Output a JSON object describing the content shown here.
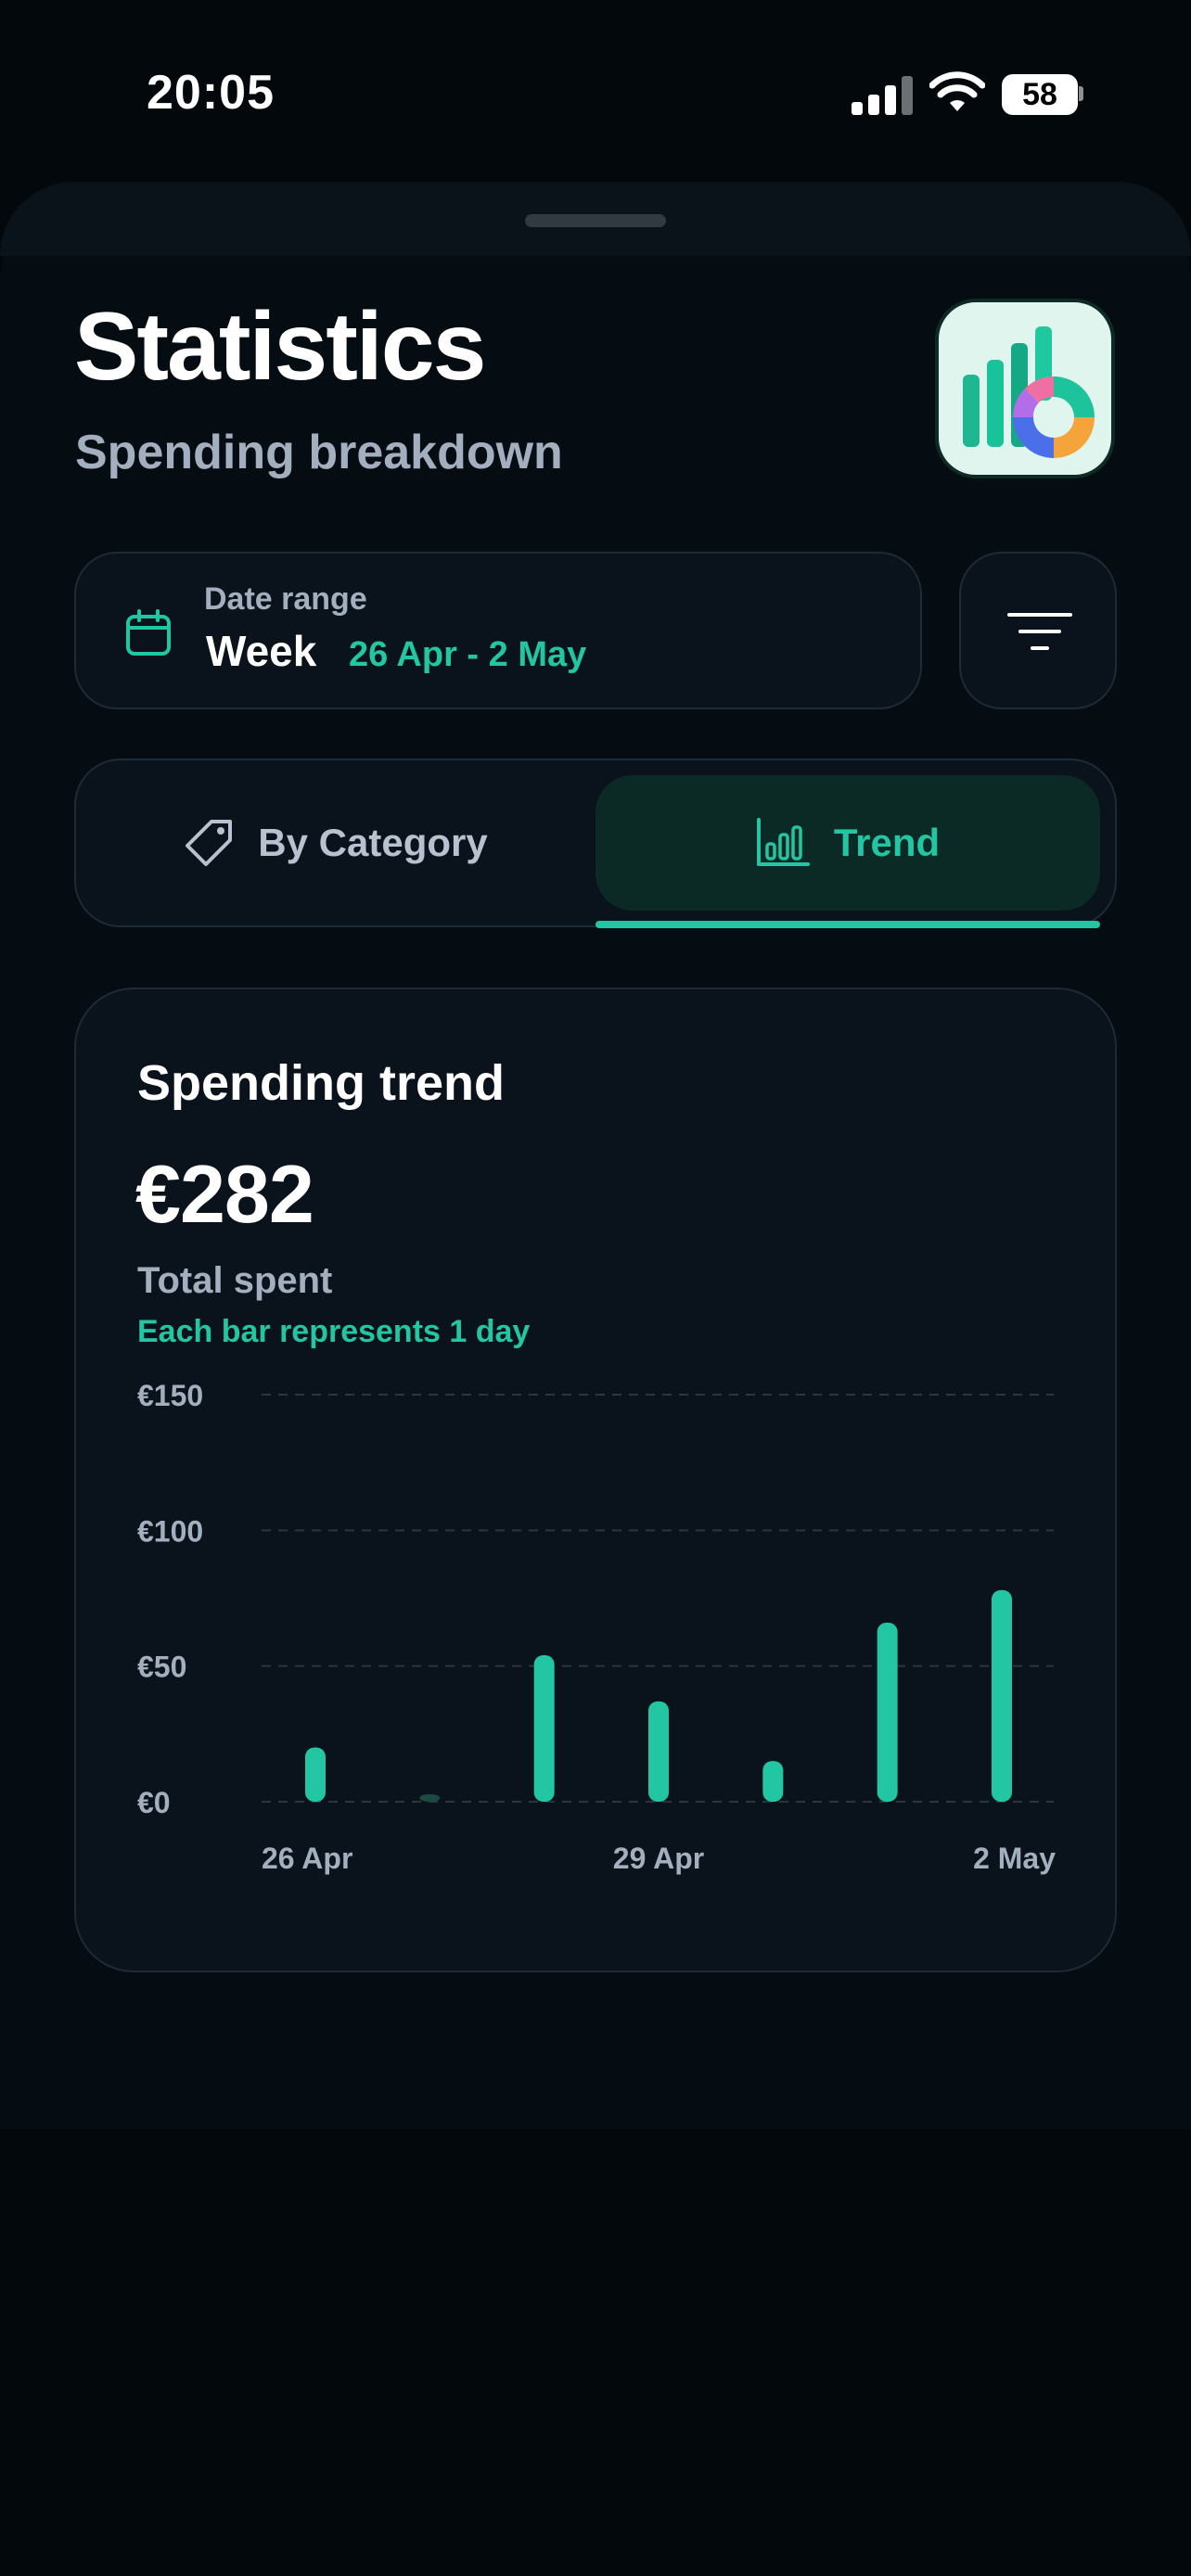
{
  "status_bar": {
    "time": "20:05",
    "battery": "58"
  },
  "header": {
    "title": "Statistics",
    "subtitle": "Spending breakdown",
    "app_icon": "chart-donut-app-icon"
  },
  "date_range": {
    "label": "Date range",
    "period": "Week",
    "value": "26 Apr - 2 May"
  },
  "filter": {
    "icon": "filter-lines-icon"
  },
  "tabs": [
    {
      "label": "By Category",
      "icon": "tag-icon",
      "active": false
    },
    {
      "label": "Trend",
      "icon": "bar-chart-icon",
      "active": true
    }
  ],
  "trend_card": {
    "title": "Spending trend",
    "total": "€282",
    "total_label": "Total spent",
    "note": "Each bar represents 1 day"
  },
  "colors": {
    "accent": "#22c6a2",
    "background": "#03080d",
    "card": "#0a131b",
    "muted_text": "#a3aebe"
  },
  "chart_data": {
    "type": "bar",
    "categories": [
      "26 Apr",
      "27 Apr",
      "28 Apr",
      "29 Apr",
      "30 Apr",
      "1 May",
      "2 May"
    ],
    "values": [
      20,
      2,
      54,
      37,
      15,
      66,
      78
    ],
    "x_tick_labels": [
      "26 Apr",
      "29 Apr",
      "2 May"
    ],
    "y_ticks": [
      0,
      50,
      100,
      150
    ],
    "y_tick_labels": [
      "€0",
      "€50",
      "€100",
      "€150"
    ],
    "ylim": [
      0,
      150
    ],
    "grid": true,
    "legend": "none"
  }
}
